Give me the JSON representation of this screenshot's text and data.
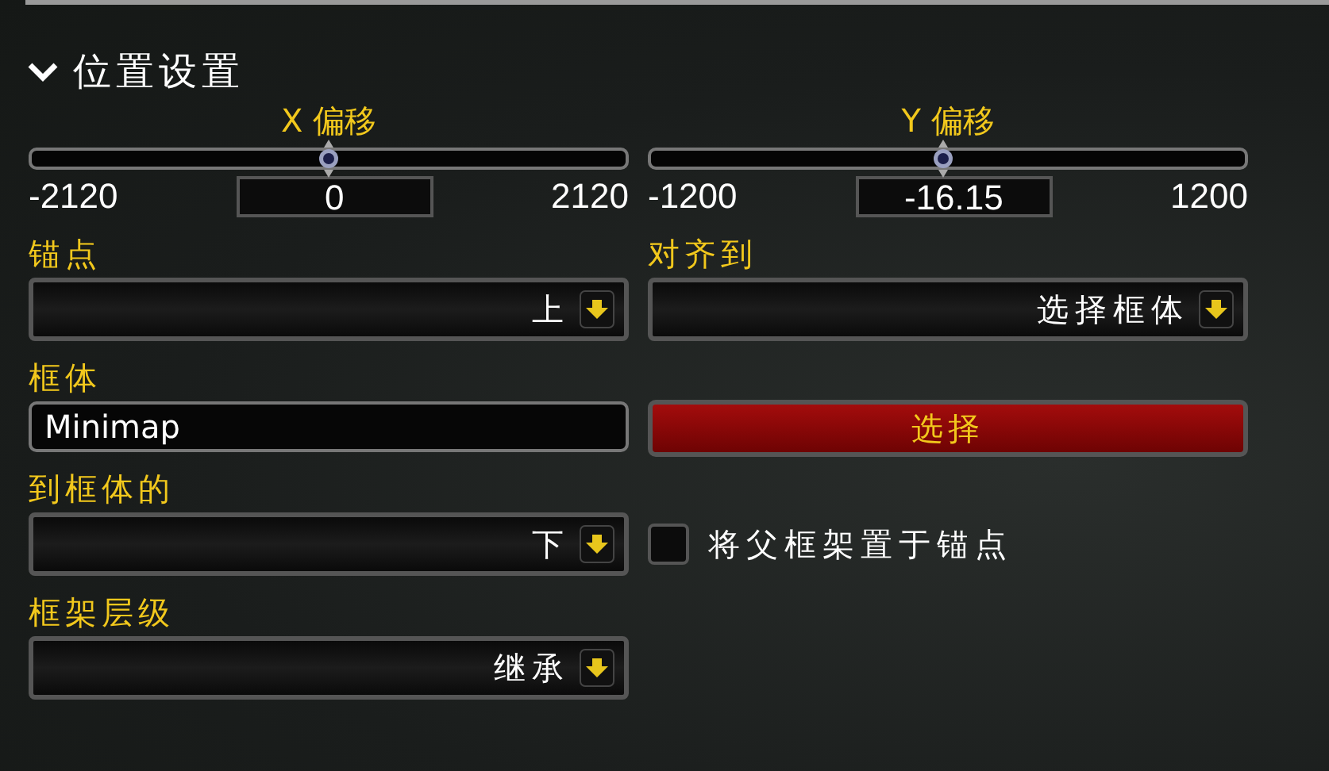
{
  "section": {
    "title": "位置设置",
    "expanded": true
  },
  "sliders": [
    {
      "label": "X 偏移",
      "min": "-2120",
      "max": "2120",
      "value": "0",
      "level": 0.5
    },
    {
      "label": "Y 偏移",
      "min": "-1200",
      "max": "1200",
      "value": "-16.15",
      "level": 0.493
    }
  ],
  "anchor": {
    "label": "锚点",
    "value": "上"
  },
  "align_to": {
    "label": "对齐到",
    "value": "选择框体"
  },
  "frame": {
    "label": "框体",
    "value": "Minimap",
    "button": "选择"
  },
  "relative_point": {
    "label": "到框体的",
    "value": "下"
  },
  "checkbox": {
    "label": "将父框架置于锚点",
    "checked": false
  },
  "strata": {
    "label": "框架层级",
    "value": "继承"
  }
}
